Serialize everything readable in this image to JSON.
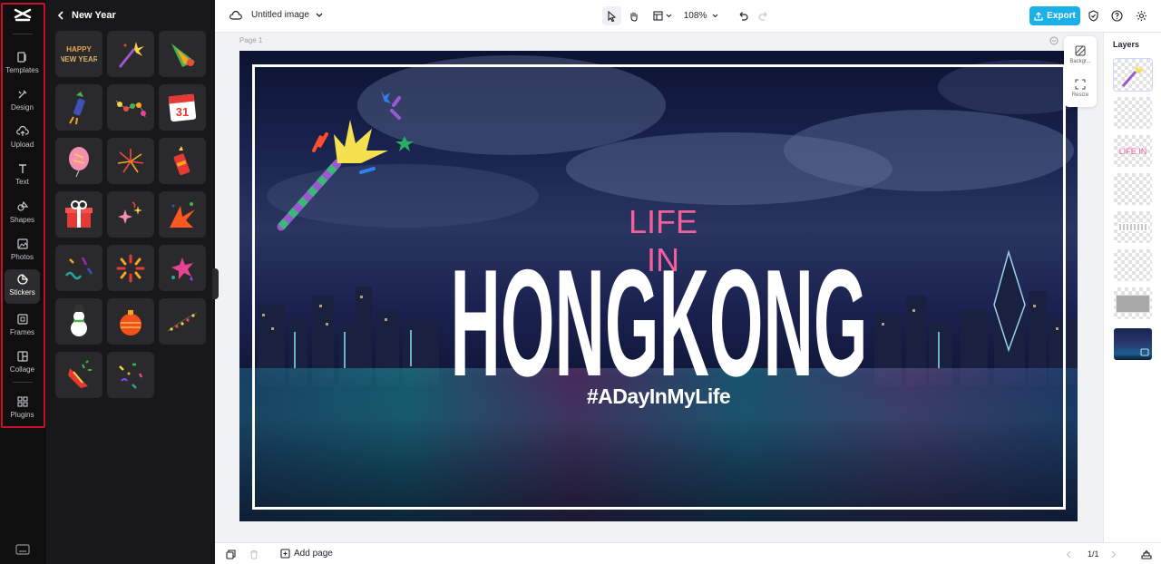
{
  "rail": {
    "items": [
      {
        "label": "Templates"
      },
      {
        "label": "Design"
      },
      {
        "label": "Upload"
      },
      {
        "label": "Text"
      },
      {
        "label": "Shapes"
      },
      {
        "label": "Photos"
      },
      {
        "label": "Stickers"
      },
      {
        "label": "Frames"
      },
      {
        "label": "Collage"
      },
      {
        "label": "Plugins"
      }
    ],
    "active": "Stickers"
  },
  "panel": {
    "title": "New Year",
    "stickers": [
      "happy-new-year-text-sticker",
      "sparkler-sticker",
      "party-hat-sticker",
      "firework-rocket-sticker",
      "string-lights-sticker",
      "calendar-31-sticker",
      "balloon-sticker",
      "fireworks-burst-sticker",
      "firecracker-sticker",
      "gift-box-sticker",
      "sparkles-sticker",
      "burst-stars-sticker",
      "confetti-squiggles-sticker",
      "radial-burst-sticker",
      "star-splash-sticker",
      "snowman-sticker",
      "ornament-sticker",
      "star-garland-sticker",
      "party-popper-sticker",
      "confetti-sticker"
    ],
    "happy_text": "HAPPY NEW YEAR",
    "calendar_day": "31"
  },
  "topbar": {
    "doc_title": "Untitled image",
    "zoom": "108%",
    "export_label": "Export"
  },
  "canvas": {
    "page_label": "Page 1",
    "life_in": "LIFE IN",
    "headline": "HONGKONG",
    "hashtag": "#ADayInMyLife"
  },
  "mini_tools": {
    "background_label": "Backgr...",
    "resize_label": "Resize"
  },
  "layers": {
    "title": "Layers",
    "items": [
      {
        "kind": "sparkler-sticker"
      },
      {
        "kind": "empty"
      },
      {
        "kind": "text",
        "text": "LIFE IN"
      },
      {
        "kind": "empty"
      },
      {
        "kind": "headline-text"
      },
      {
        "kind": "empty"
      },
      {
        "kind": "frame"
      },
      {
        "kind": "background-photo"
      }
    ]
  },
  "bottombar": {
    "add_page_label": "Add page",
    "page_count": "1/1"
  },
  "colors": {
    "accent": "#1bb1e8",
    "pink_text": "#f0609c",
    "rail_highlight": "#c8102e"
  }
}
